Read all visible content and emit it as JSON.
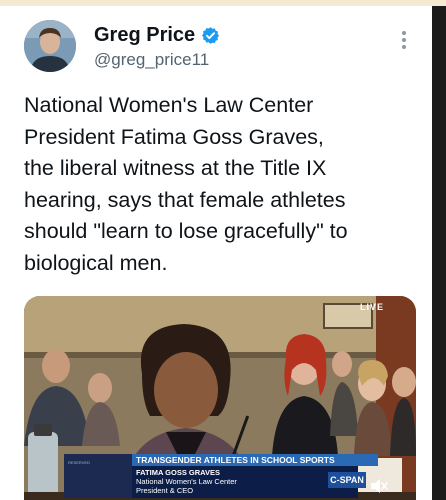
{
  "tweet": {
    "author_name": "Greg Price",
    "author_handle": "@greg_price11",
    "text": "National Women's Law Center\nPresident Fatima Goss Graves,\nthe liberal witness at the Title IX\nhearing, says that female athletes\nshould \"learn to lose gracefully\" to\nbiological men."
  },
  "video": {
    "live_label": "LIVE",
    "chyron_title": "TRANSGENDER ATHLETES IN SCHOOL SPORTS",
    "chyron_name": "FATIMA GOSS GRAVES",
    "chyron_line1": "National Women's Law Center",
    "chyron_line2": "President & CEO",
    "chyron_left_text": "RESERVED",
    "network_logo": "C-SPAN"
  },
  "icons": {
    "verified": "verified-badge-icon",
    "more": "more-dots-icon",
    "mute": "mute-icon"
  },
  "colors": {
    "verified": "#1d9bf0",
    "text": "#0f1419",
    "handle": "#536471",
    "chyron_title_bg": "#2a6ab5",
    "chyron_body_bg": "#0c1e48"
  }
}
